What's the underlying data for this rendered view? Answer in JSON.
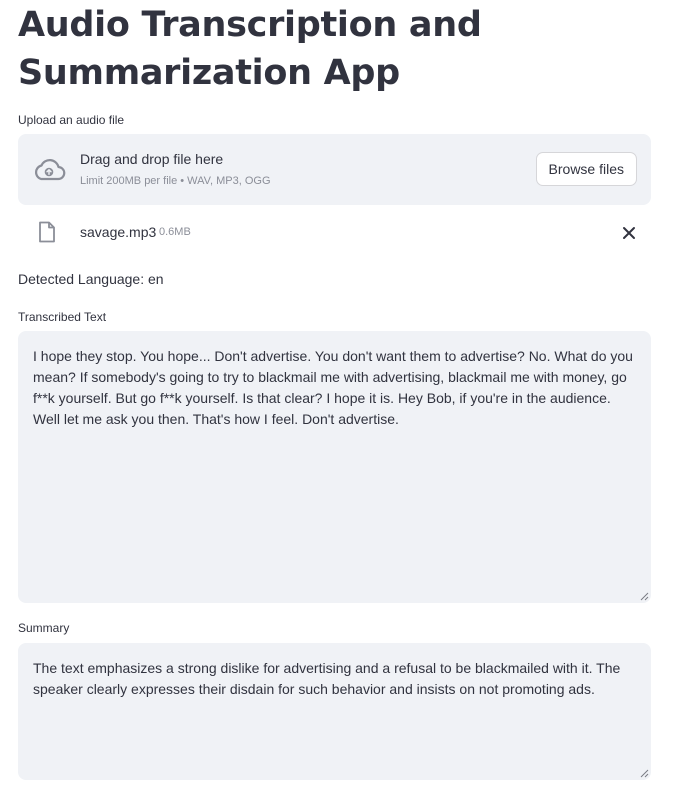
{
  "app": {
    "title_line1": "Audio Transcription and",
    "title_line2": "Summarization App"
  },
  "uploader": {
    "label": "Upload an audio file",
    "drop_text": "Drag and drop file here",
    "limit_text": "Limit 200MB per file • WAV, MP3, OGG",
    "browse_label": "Browse files",
    "icon": "cloud-upload-icon"
  },
  "file": {
    "name": "savage.mp3",
    "size": "0.6MB",
    "icon": "file-icon",
    "remove_icon": "close-icon"
  },
  "detected_language": "Detected Language: en",
  "transcription": {
    "label": "Transcribed Text",
    "value": "I hope they stop. You hope... Don't advertise. You don't want them to advertise? No. What do you mean? If somebody's going to try to blackmail me with advertising, blackmail me with money, go f**k yourself. But go f**k yourself. Is that clear? I hope it is. Hey Bob, if you're in the audience. Well let me ask you then. That's how I feel. Don't advertise."
  },
  "summary": {
    "label": "Summary",
    "value": "The text emphasizes a strong dislike for advertising and a refusal to be blackmailed with it. The speaker clearly expresses their disdain for such behavior and insists on not promoting ads."
  },
  "colors": {
    "text": "#31333f",
    "muted": "#8b8e98",
    "panel_bg": "#f0f2f6",
    "border": "#d6d6d9"
  }
}
